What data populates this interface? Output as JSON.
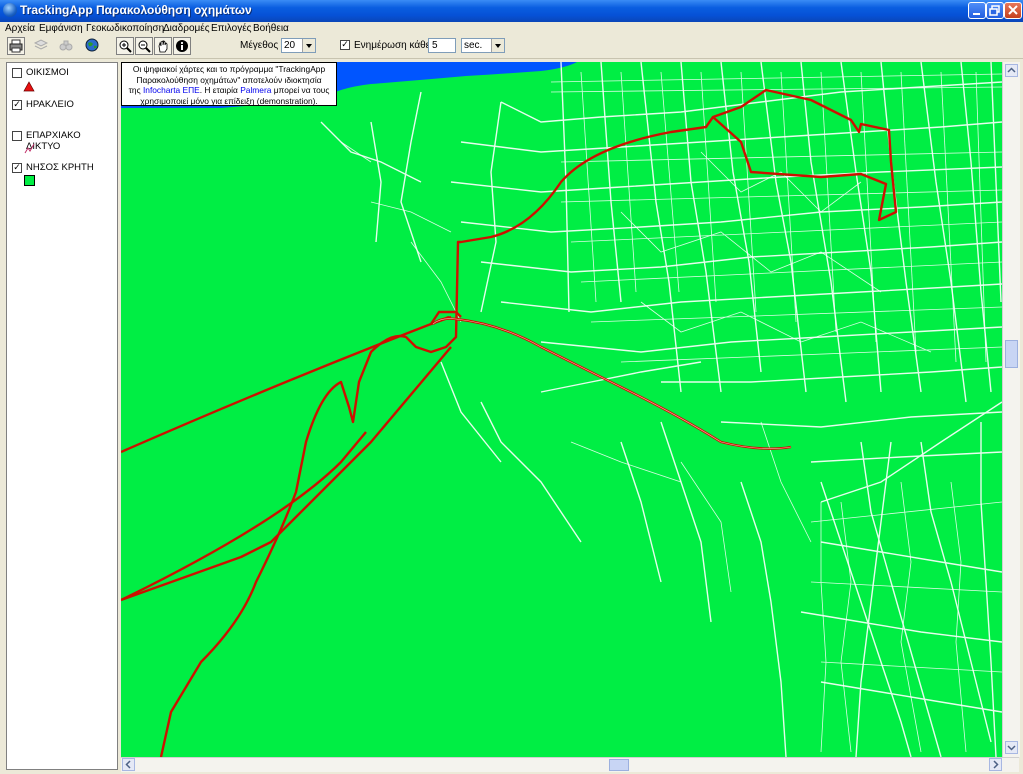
{
  "window": {
    "title": "TrackingApp Παρακολούθηση οχημάτων"
  },
  "menu": [
    "Αρχεία",
    "Εμφάνιση",
    "Γεοκωδικοποίηση",
    "Διαδρομές",
    "Επιλογές",
    "Βοήθεια"
  ],
  "toolbar": {
    "size_label": "Μέγεθος",
    "size_value": "20",
    "update_label": "Ενημέρωση κάθε",
    "update_checked": true,
    "update_value": "5",
    "unit_value": "sec."
  },
  "legend": {
    "items": [
      {
        "label": "ΟΙΚΙΣΜΟΙ",
        "checked": false,
        "symbol": "red-triangle"
      },
      {
        "label": "ΗΡΑΚΛΕΙΟ",
        "checked": true,
        "symbol": "none"
      },
      {
        "label": "ΕΠΑΡΧΙΑΚΟ ΔΙΚΤΥΟ",
        "checked": false,
        "symbol": "road-line"
      },
      {
        "label": "ΝΗΣΟΣ ΚΡΗΤΗ",
        "checked": true,
        "symbol": "green-square"
      }
    ]
  },
  "notice": {
    "line1": "Οι ψηφιακοί χάρτες και το πρόγραμμα \"TrackingApp",
    "line2": "Παρακολούθηση οχημάτων\" αποτελούν ιδιοκτησία",
    "line3_pre": "της ",
    "line3_link1": "Infocharta ΕΠΕ",
    "line3_mid": ". Η εταιρία ",
    "line3_link2": "Palmera",
    "line3_post": " μπορεί να τους",
    "line4": "χρησιμοποιεί μόνο για επίδειξη (demonstration)."
  },
  "colors": {
    "land": "#00ee44",
    "sea": "#0055ff",
    "roads": "#ffffff",
    "route": "#cc1100"
  }
}
